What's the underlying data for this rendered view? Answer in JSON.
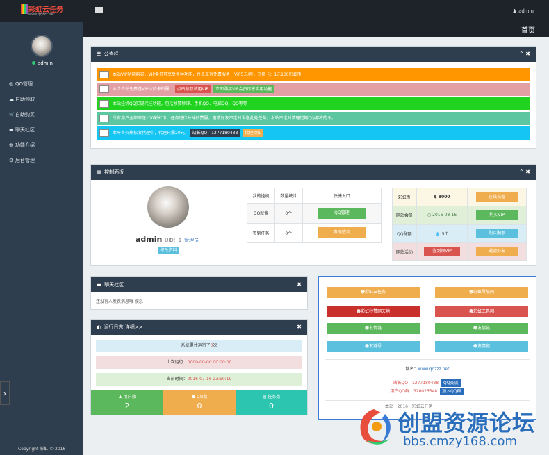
{
  "topbar": {
    "logo_text": "彩虹云任务",
    "logo_url": "www.qqzzz.net",
    "user": "admin",
    "user_caret": "v"
  },
  "sidebar": {
    "username": "admin",
    "items": [
      {
        "icon": "◎",
        "label": "QQ管理"
      },
      {
        "icon": "☁",
        "label": "自助领取"
      },
      {
        "icon": "🛒",
        "label": "自助购买"
      },
      {
        "icon": "▬",
        "label": "聊天社区"
      },
      {
        "icon": "⊕",
        "label": "功能介绍"
      },
      {
        "icon": "⚙",
        "label": "后台管理"
      }
    ],
    "copyright": "Copyright 彩虹 © 2016",
    "toggle": "›"
  },
  "header": {
    "home": "首页"
  },
  "notice_panel": {
    "title": "公告栏",
    "rows": [
      {
        "text": "本站VIP功能购买，VIP会员可享受各种功能，并且享有免费服务！VIP5元/月，充值卡：1元100彩虹币",
        "color": "#ff9600"
      },
      {
        "text": "本个个站免费送VIP体验卡所需：",
        "chips": [
          {
            "label": "点击领取试用VIP",
            "color": "#d9534f"
          },
          {
            "label": "立即购买VIP会员尽享实用功能",
            "color": "#5cb85c"
          }
        ],
        "color": "#e2a0a4"
      },
      {
        "text": "本站挂机QQ实现代挂功能，包括秒赞秒评、手机QQ、电脑QQ、QQ等等",
        "color": "#1fd31f"
      },
      {
        "text": "所有用户全部赠送100彩虹币。任务进行分钟秒赞服，邀请好友不定时发送此处任务，本站不定时清理过期QQ都将的令。",
        "color": "#5bc6a0"
      },
      {
        "text": "本平台火热招收代理中，代理只需20元，",
        "chips": [
          {
            "label": "站长QQ：1277180438",
            "color": "#2f3e4e"
          },
          {
            "label": "代理须知",
            "color": "#f0ad4e"
          }
        ],
        "color": "#15c6f5"
      }
    ],
    "tools": "⌃ ✖"
  },
  "control_panel": {
    "title": "控制面板",
    "profile": {
      "name": "admin",
      "uid_label": "UID：1",
      "role": "管理员",
      "edit": "修改资料"
    },
    "task_table": {
      "headers": [
        "我的挂机",
        "数量统计",
        "快捷入口"
      ],
      "rows": [
        {
          "label": "QQ就像",
          "count": "0个",
          "action": "QQ管理",
          "color": "#5cb85c"
        },
        {
          "label": "签到任务",
          "count": "0个",
          "action": "自助签到",
          "color": "#f0ad4e"
        }
      ]
    },
    "account_table": {
      "rows": [
        {
          "label": "彩虹币",
          "value": "$ 8000",
          "action": "在线充值",
          "color": "#f0ad4e",
          "bg": "#fcf7e5"
        },
        {
          "label": "网站会员",
          "value": "◷ 2016-08-16",
          "action": "购买VIP",
          "color": "#5cb85c",
          "bg": "#e0f0d8"
        },
        {
          "label": "QQ配额",
          "value": "💧 5个",
          "action": "购买配额",
          "color": "#5bc0de",
          "bg": "#d9edf7"
        },
        {
          "label": "网站活动",
          "value": "签到领VIP",
          "action": "邀请好友",
          "color": "#d9534f",
          "bg": "#f2dede",
          "value_btn": true,
          "action_color": "#f0ad4e"
        }
      ]
    },
    "tools": "⌃ ✖"
  },
  "chat_panel": {
    "title": "聊天社区",
    "text": "还没有人发表消息哦 娱乐",
    "close": "✖"
  },
  "runtime_panel": {
    "title": "运行日志 详细>>",
    "close": "✖",
    "lines": [
      {
        "text": "系统累计运行了",
        "num": "0",
        "suffix": "次",
        "bg": "#d9edf7"
      },
      {
        "text": "上次运行：",
        "value": "0000-00-00 00:00:00",
        "bg": "#f2dede"
      },
      {
        "text": "当前时间：",
        "value": "2016-07-16 23:50:19",
        "bg": "#dff0d8"
      }
    ],
    "stats": [
      {
        "label": "用户数",
        "icon": "♟",
        "value": "2",
        "color": "#5cb85c"
      },
      {
        "label": "QQ数",
        "icon": "☗",
        "value": "0",
        "color": "#f0ad4e"
      },
      {
        "label": "任务数",
        "icon": "▤",
        "value": "0",
        "color": "#2cc6b0"
      }
    ]
  },
  "links_panel": {
    "buttons": [
      {
        "label": "☻彩虹云任务",
        "color": "#f0ad4e"
      },
      {
        "label": "☻彩虹导航网",
        "color": "#f0ad4e"
      },
      {
        "label": "☻彩虹秒赞网天地",
        "color": "#c9302c"
      },
      {
        "label": "☻彩虹工具网",
        "color": "#d9534f"
      },
      {
        "label": "☻友情链",
        "color": "#5cb85c"
      },
      {
        "label": "☻友情链",
        "color": "#5cb85c"
      },
      {
        "label": "☻友链号",
        "color": "#5bc0de"
      },
      {
        "label": "☻友情链",
        "color": "#5bc0de"
      }
    ],
    "domain_label": "域名：",
    "domain": "www.qqzzz.net",
    "qq_label": "站长QQ：1277180438",
    "qq_btn": "QQ交谈",
    "group_label": "用户QQ群：326025548",
    "group_btn": "加入QQ群",
    "footer": "本站 · 2016 · 彩虹云任务"
  },
  "watermark": {
    "title": "创盟资源论坛",
    "url": "bbs.cmzy168.com"
  }
}
